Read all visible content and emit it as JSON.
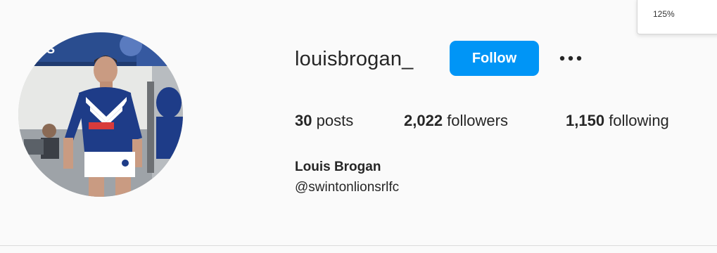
{
  "zoom": {
    "label": "125%"
  },
  "profile": {
    "username": "louisbrogan_",
    "follow_label": "Follow",
    "stats": {
      "posts_count": "30",
      "posts_label": "posts",
      "followers_count": "2,022",
      "followers_label": "followers",
      "following_count": "1,150",
      "following_label": "following"
    },
    "full_name": "Louis Brogan",
    "bio_link": "@swintonlionsrlfc"
  },
  "colors": {
    "follow_button": "#0095f6",
    "text": "#262626",
    "background": "#fafafa"
  },
  "icons": {
    "more": "more-options-icon"
  }
}
